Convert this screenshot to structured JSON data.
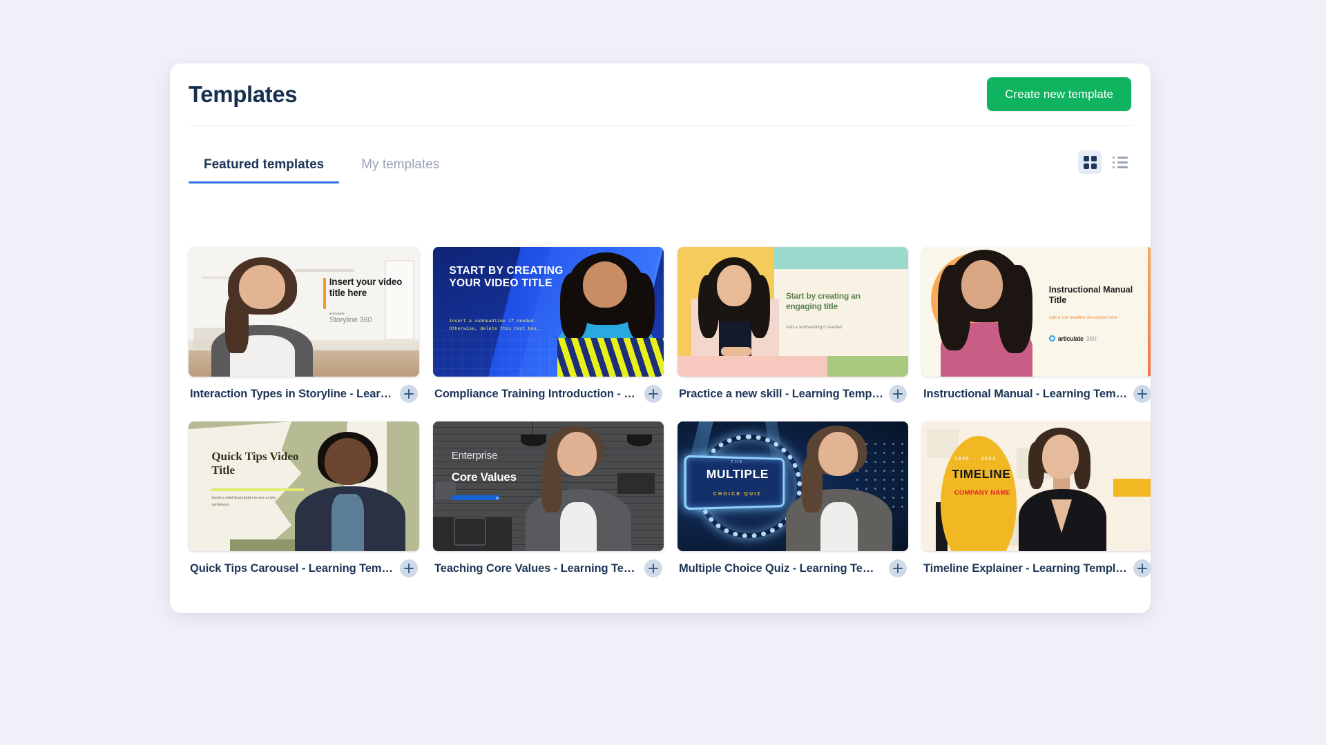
{
  "page": {
    "background_color": "#f0f0f9",
    "panel_background": "#ffffff"
  },
  "header": {
    "title": "Templates",
    "create_button_label": "Create new template",
    "create_button_color": "#10b35f"
  },
  "tabs": {
    "active_index": 0,
    "accent_color": "#2f6fe4",
    "items": [
      {
        "label": "Featured templates",
        "active": true
      },
      {
        "label": "My templates",
        "active": false
      }
    ]
  },
  "view_toggle": {
    "active": "grid",
    "grid_label": "Grid view",
    "list_label": "List view",
    "active_background": "#e4eaf6"
  },
  "templates": [
    {
      "title": "Interaction Types in Storyline - Learni...",
      "full_title": "Interaction Types in Storyline - Learning Template",
      "add_label": "+",
      "thumbnail": {
        "style": "t1",
        "heading": "Insert your video title here",
        "brand_small": "articulate",
        "brand": "Storyline 360",
        "accent_color": "#f59b2a"
      }
    },
    {
      "title": "Compliance Training Introduction - L...",
      "full_title": "Compliance Training Introduction - Learning Template",
      "add_label": "+",
      "thumbnail": {
        "style": "t2",
        "heading": "START BY CREATING YOUR VIDEO TITLE",
        "subheading": "Insert a subheadline if needed. Otherwise, delete this text box.",
        "accent_color": "#e9ef18",
        "background_color": "#122a8f"
      }
    },
    {
      "title": "Practice a new skill - Learning Templa...",
      "full_title": "Practice a new skill - Learning Template",
      "add_label": "+",
      "thumbnail": {
        "style": "t3",
        "heading": "Start by creating an engaging title",
        "subheading": "Add a subheading if needed",
        "accent_color": "#5e8355",
        "background_color": "#f7f2e4"
      }
    },
    {
      "title": "Instructional Manual - Learning Temp...",
      "full_title": "Instructional Manual - Learning Template",
      "add_label": "+",
      "thumbnail": {
        "style": "t4",
        "heading": "Instructional Manual Title",
        "subheading": "Add a sub-headline description here",
        "brand": "articulate",
        "brand_suffix": "360",
        "accent_color": "#f8a95a"
      }
    },
    {
      "title": "Quick Tips Carousel - Learning Templ...",
      "full_title": "Quick Tips Carousel - Learning Template",
      "add_label": "+",
      "thumbnail": {
        "style": "t5",
        "heading": "Quick Tips Video Title",
        "subheading": "Insert a brief description in one or two sentences",
        "accent_color": "#e0ec6a"
      }
    },
    {
      "title": "Teaching Core Values - Learning Tem...",
      "full_title": "Teaching Core Values - Learning Template",
      "add_label": "+",
      "thumbnail": {
        "style": "t6",
        "eyebrow": "Enterprise",
        "heading": "Core Values",
        "accent_color": "#1464d6"
      }
    },
    {
      "title": "Multiple Choice Quiz - Learning Temp...",
      "full_title": "Multiple Choice Quiz - Learning Template",
      "add_label": "+",
      "thumbnail": {
        "style": "t7",
        "eyebrow": "THE",
        "heading": "MULTIPLE",
        "subheading": "CHOICE QUIZ",
        "accent_color": "#e8c134"
      }
    },
    {
      "title": "Timeline Explainer - Learning Template",
      "full_title": "Timeline Explainer - Learning Template",
      "add_label": "+",
      "thumbnail": {
        "style": "t8",
        "eyebrow": "1835 - 2022",
        "heading": "TIMELINE",
        "subheading": "COMPANY NAME",
        "accent_color": "#f2b823"
      }
    }
  ]
}
